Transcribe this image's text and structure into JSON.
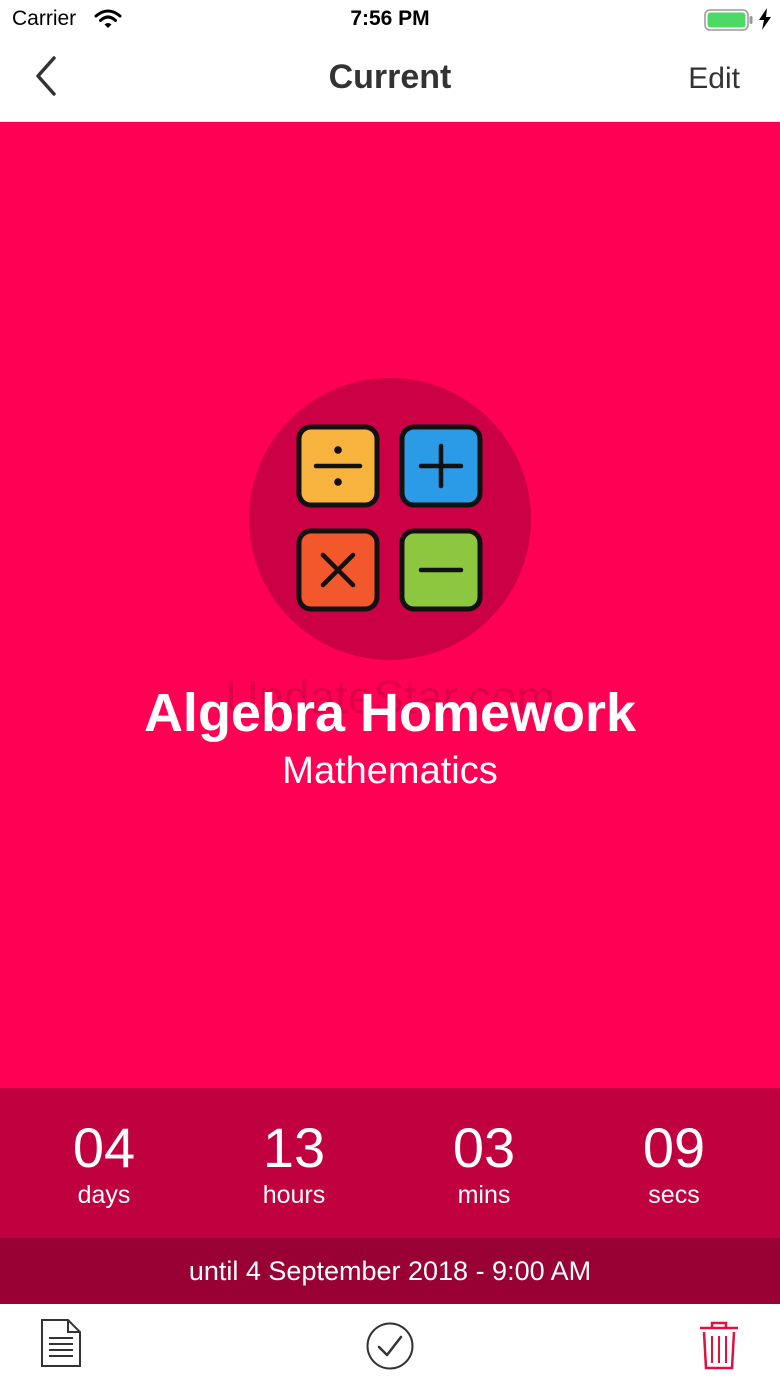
{
  "status_bar": {
    "carrier": "Carrier",
    "time": "7:56 PM",
    "wifi_icon": "wifi-icon",
    "battery_icon": "battery-icon",
    "charging_icon": "charging-bolt-icon"
  },
  "nav": {
    "back_icon": "chevron-left-icon",
    "title": "Current",
    "edit_label": "Edit"
  },
  "task": {
    "icon": "math-operators-icon",
    "title": "Algebra Homework",
    "subject": "Mathematics",
    "watermark": "UpdateStar.com"
  },
  "countdown": {
    "days": {
      "value": "04",
      "label": "days"
    },
    "hours": {
      "value": "13",
      "label": "hours"
    },
    "mins": {
      "value": "03",
      "label": "mins"
    },
    "secs": {
      "value": "09",
      "label": "secs"
    },
    "until": "until 4 September 2018 - 9:00 AM"
  },
  "toolbar": {
    "notes_icon": "document-icon",
    "complete_icon": "checkmark-circle-icon",
    "delete_icon": "trash-icon"
  },
  "colors": {
    "hero_background": "#ff0055",
    "icon_circle": "#cc0044",
    "countdown_background": "#c10040",
    "until_background": "#990033",
    "delete_icon": "#e0103f",
    "divide_tile": "#f7b33e",
    "plus_tile": "#2b9be8",
    "times_tile": "#f2582b",
    "minus_tile": "#8dc63f"
  }
}
